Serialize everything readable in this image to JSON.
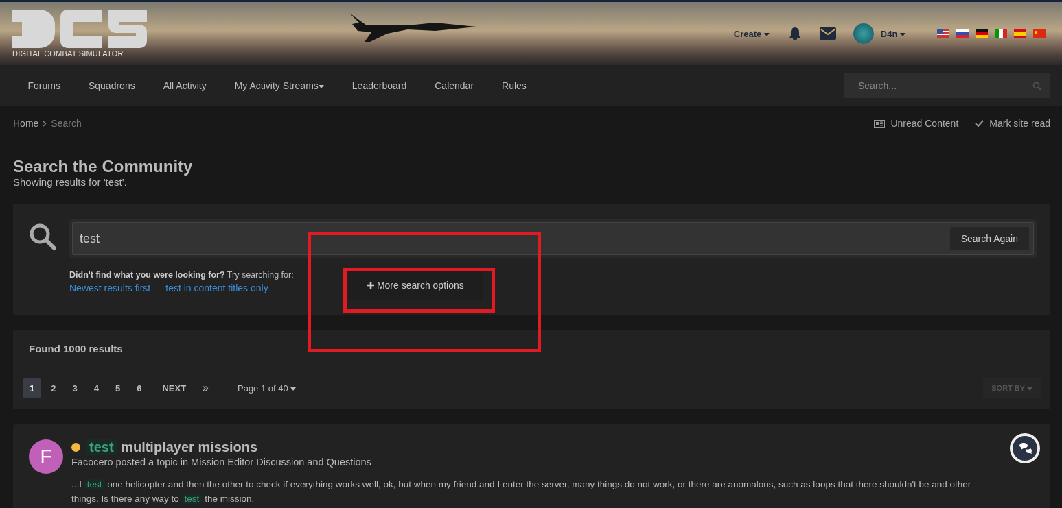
{
  "header": {
    "logo_text": "DIGITAL COMBAT SIMULATOR",
    "create_label": "Create",
    "username": "D4n"
  },
  "nav": {
    "items": [
      {
        "label": "Forums",
        "dropdown": false
      },
      {
        "label": "Squadrons",
        "dropdown": false
      },
      {
        "label": "All Activity",
        "dropdown": false
      },
      {
        "label": "My Activity Streams",
        "dropdown": true
      },
      {
        "label": "Leaderboard",
        "dropdown": false
      },
      {
        "label": "Calendar",
        "dropdown": false
      },
      {
        "label": "Rules",
        "dropdown": false
      }
    ],
    "search_placeholder": "Search..."
  },
  "breadcrumb": {
    "items": [
      "Home",
      "Search"
    ],
    "actions": [
      "Unread Content",
      "Mark site read"
    ]
  },
  "page": {
    "title": "Search the Community",
    "subtitle": "Showing results for 'test'."
  },
  "search": {
    "value": "test",
    "button": "Search Again",
    "hint_bold": "Didn't find what you were looking for?",
    "hint_rest": "Try searching for:",
    "suggestions": [
      "Newest results first",
      "test in content titles only"
    ],
    "more_options": "More search options"
  },
  "results": {
    "count": "Found 1000 results",
    "pages": [
      {
        "label": "1",
        "selected": true
      },
      {
        "label": "2",
        "selected": false
      },
      {
        "label": "3",
        "selected": false
      },
      {
        "label": "4",
        "selected": false
      },
      {
        "label": "5",
        "selected": false
      },
      {
        "label": "6",
        "selected": false
      }
    ],
    "next": "NEXT",
    "last": "»",
    "page_of": "Page 1 of 40",
    "sort": "SORT BY"
  },
  "items": [
    {
      "avatar_letter": "F",
      "title": [
        {
          "text": "test",
          "highlight": true
        },
        {
          "text": "multiplayer missions",
          "highlight": false
        }
      ],
      "meta": "Facocero posted a topic in Mission Editor Discussion and Questions",
      "snippet": [
        {
          "text": "...I",
          "highlight": false
        },
        {
          "text": "test",
          "highlight": true
        },
        {
          "text": "one helicopter and then the other to check if everything works well, ok, but when my friend and I enter the server, many things do not work, or there are anomalous, such as loops that there shouldn't be and other things. Is there any way to",
          "highlight": false
        },
        {
          "text": "test",
          "highlight": true
        },
        {
          "text": "the mission.",
          "highlight": false
        }
      ]
    }
  ]
}
